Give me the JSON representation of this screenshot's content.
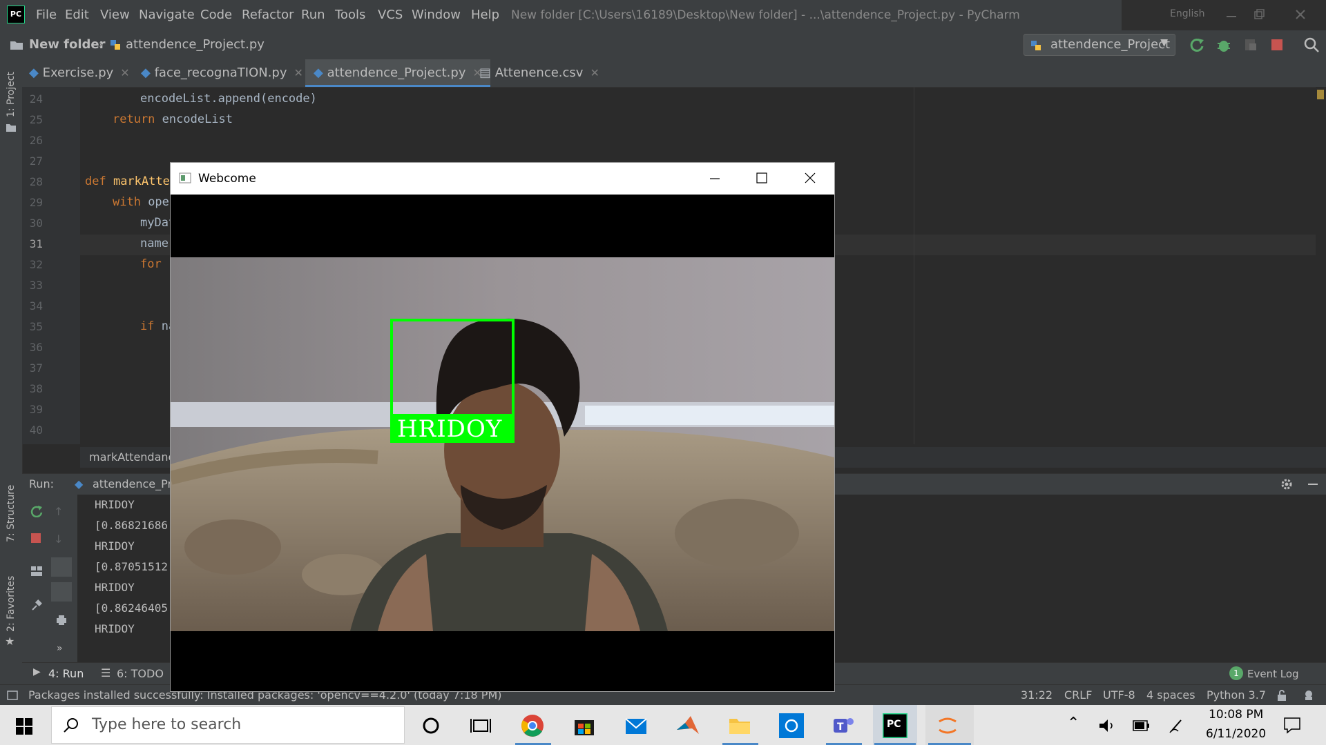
{
  "window": {
    "title": "New folder [C:\\Users\\16189\\Desktop\\New folder] - ...\\attendence_Project.py - PyCharm",
    "logo_text": "PC",
    "language": "English"
  },
  "menu": [
    "File",
    "Edit",
    "View",
    "Navigate",
    "Code",
    "Refactor",
    "Run",
    "Tools",
    "VCS",
    "Window",
    "Help"
  ],
  "nav": {
    "folder": "New folder",
    "file": "attendence_Project.py",
    "run_config": "attendence_Project"
  },
  "side_tools": {
    "project": "1: Project",
    "structure": "7: Structure",
    "favorites": "2: Favorites"
  },
  "tabs": [
    {
      "label": "Exercise.py"
    },
    {
      "label": "face_recognaTION.py"
    },
    {
      "label": "attendence_Project.py"
    },
    {
      "label": "Attenence.csv"
    }
  ],
  "code": {
    "line_numbers": [
      "24",
      "25",
      "26",
      "27",
      "28",
      "29",
      "30",
      "31",
      "32",
      "33",
      "34",
      "35",
      "36",
      "37",
      "38",
      "39",
      "40"
    ],
    "l24": "encodeList.append(encode)",
    "l25_kw": "return",
    "l25_rest": " encodeList",
    "l28_kw": "def",
    "l28_fn": " markAtten",
    "l29_kw": "with",
    "l29_rest": " ope",
    "l30": "myDat",
    "l31": "name",
    "l32_kw": "for",
    "l35_kw": "if",
    "l35_rest": " na"
  },
  "breadcrumb": "markAttendanc",
  "run": {
    "label": "Run:",
    "tab": "attendence_Pr",
    "output": [
      "HRIDOY",
      "[0.86821686",
      "HRIDOY",
      "[0.87051512",
      "HRIDOY",
      "[0.86246405",
      "HRIDOY"
    ]
  },
  "bottom_tools": {
    "run": "4: Run",
    "todo": "6: TODO",
    "event_log": "Event Log",
    "event_count": "1"
  },
  "status": {
    "message": "Packages installed successfully: Installed packages: 'opencv==4.2.0' (today 7:18 PM)",
    "position": "31:22",
    "line_sep": "CRLF",
    "encoding": "UTF-8",
    "indent": "4 spaces",
    "interpreter": "Python 3.7"
  },
  "webcam": {
    "title": "Webcome",
    "face_label": "HRIDOY"
  },
  "taskbar": {
    "search_placeholder": "Type here to search",
    "time": "10:08 PM",
    "date": "6/11/2020"
  },
  "colors": {
    "accent_blue": "#4a88c7",
    "detect_green": "#00ff00",
    "keyword": "#cc7832",
    "function": "#ffc66d"
  }
}
